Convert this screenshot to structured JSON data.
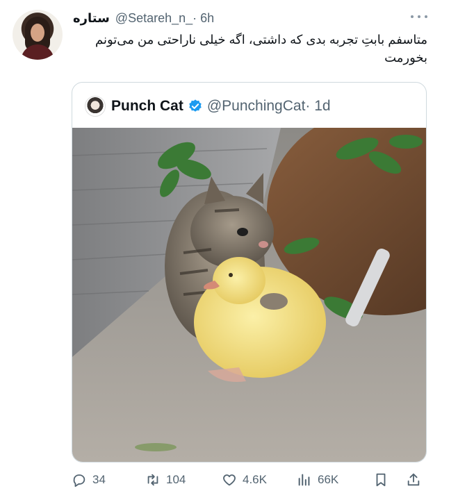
{
  "tweet": {
    "author_name": "ستاره",
    "handle": "@Setareh_n_",
    "time": "· 6h",
    "text": "متاسفم بابتِ تجربه بدی که داشتی، اگه خیلی ناراحتی من می‌تونم بخورمت"
  },
  "quoted": {
    "author_name": "Punch Cat",
    "handle": "@PunchingCat",
    "time": "· 1d",
    "media_icon": "photo-kitten-duckling"
  },
  "actions": {
    "replies": "34",
    "retweets": "104",
    "likes": "4.6K",
    "views": "66K"
  },
  "colors": {
    "text": "#0f1419",
    "secondary": "#536471",
    "border": "#cfd9de",
    "verified": "#1d9bf0"
  }
}
